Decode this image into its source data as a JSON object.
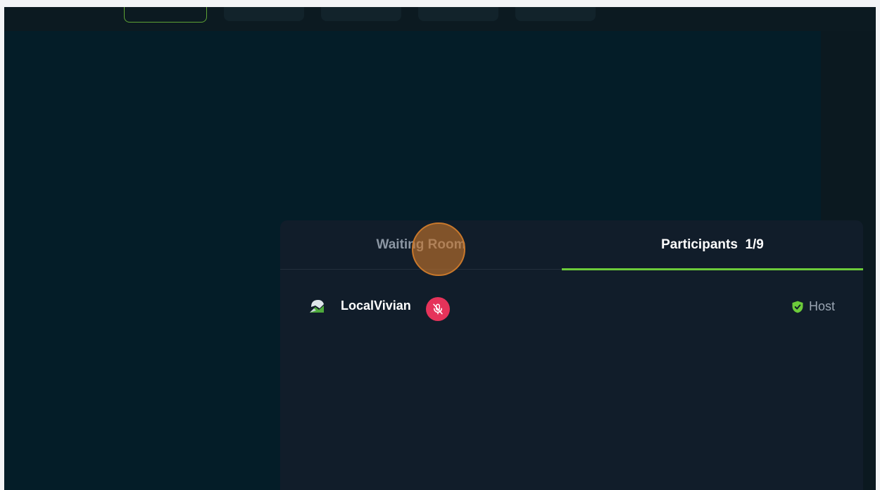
{
  "window": {
    "background": "#041d28"
  },
  "tabs": [
    {
      "label": "Waiting Room",
      "active": false
    },
    {
      "label": "Participants  1/9",
      "active": true
    }
  ],
  "participants": [
    {
      "name": "LocalVivian",
      "muted": true,
      "role": "Host",
      "avatar_icon": "broken-image-icon",
      "mute_icon": "mic-off-icon",
      "role_icon": "shield-check-icon"
    }
  ],
  "colors": {
    "accent": "#6ccb3a",
    "mute": "#e5335a",
    "panel": "#111d2a"
  }
}
